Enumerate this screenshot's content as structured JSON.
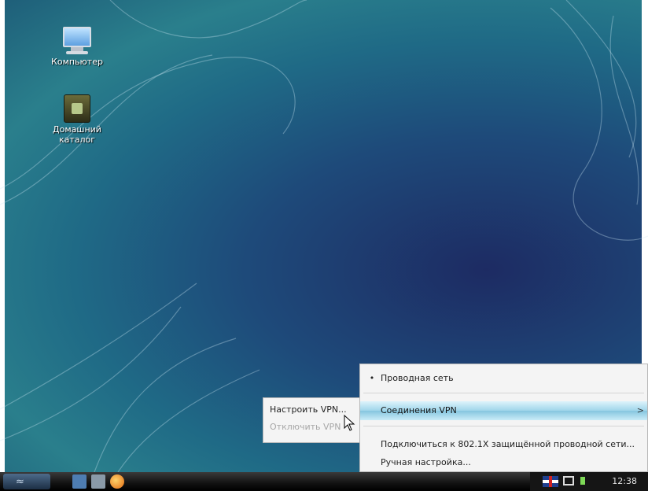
{
  "desktop": {
    "icons": [
      {
        "label": "Компьютер",
        "icon": "computer-icon"
      },
      {
        "label": "Домашний каталог",
        "icon": "home-folder-icon"
      }
    ]
  },
  "network_menu": {
    "items": [
      {
        "label": "Проводная сеть",
        "selected": true
      },
      {
        "label": "Соединения VPN",
        "submenu": true,
        "highlighted": true
      },
      {
        "label": "Подключиться к 802.1X защищённой проводной сети..."
      },
      {
        "label": "Ручная настройка..."
      }
    ],
    "submenu_arrow": ">"
  },
  "vpn_submenu": {
    "items": [
      {
        "label": "Настроить VPN...",
        "enabled": true
      },
      {
        "label": "Отключить VPN",
        "enabled": false
      }
    ]
  },
  "taskbar": {
    "clock": "12:38",
    "tray_icons": [
      "keyboard-layout-flag-icon",
      "network-icon",
      "volume-icon"
    ],
    "launchers": [
      "show-desktop-icon",
      "file-manager-icon",
      "firefox-icon"
    ]
  }
}
